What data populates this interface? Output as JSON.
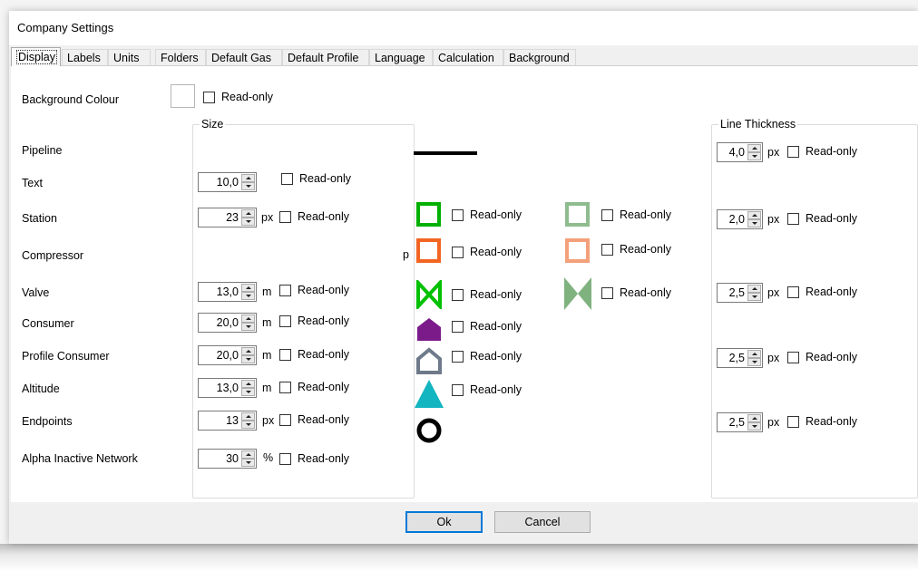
{
  "window": {
    "title": "Company Settings"
  },
  "tabs": [
    "Display",
    "Labels",
    "Units",
    "Folders",
    "Default Gas",
    "Default Profile",
    "Language",
    "Calculation",
    "Background"
  ],
  "display": {
    "background_colour_label": "Background Colour",
    "readonly_label": "Read-only",
    "size_group_title": "Size",
    "line_thickness_group_title": "Line Thickness",
    "rows": {
      "pipeline": {
        "label": "Pipeline",
        "line_thickness": "4,0",
        "line_unit": "px"
      },
      "text": {
        "label": "Text",
        "size": "10,0"
      },
      "station": {
        "label": "Station",
        "size": "23",
        "unit": "px",
        "line_thickness": "2,0",
        "line_unit": "px"
      },
      "compressor": {
        "label": "Compressor",
        "stray_text": "p"
      },
      "valve": {
        "label": "Valve",
        "size": "13,0",
        "unit": "m",
        "line_thickness": "2,5",
        "line_unit": "px"
      },
      "consumer": {
        "label": "Consumer",
        "size": "20,0",
        "unit": "m"
      },
      "profile_consumer": {
        "label": "Profile Consumer",
        "size": "20,0",
        "unit": "m",
        "line_thickness": "2,5",
        "line_unit": "px"
      },
      "altitude": {
        "label": "Altitude",
        "size": "13,0",
        "unit": "m"
      },
      "endpoints": {
        "label": "Endpoints",
        "size": "13",
        "unit": "px",
        "line_thickness": "2,5",
        "line_unit": "px"
      },
      "alpha": {
        "label": "Alpha Inactive Network",
        "size": "30",
        "unit": "%"
      }
    },
    "colors": {
      "station_active": "#00b000",
      "station_inactive": "#8fbc8f",
      "compressor_active": "#f26522",
      "compressor_inactive": "#f4a07a",
      "valve_active": "#00c000",
      "valve_inactive": "#7fb27f",
      "consumer": "#7b1b8a",
      "profile_consumer": "#6e7a8a",
      "altitude": "#12b5c0",
      "endpoint": "#000000"
    }
  },
  "footer": {
    "ok": "Ok",
    "cancel": "Cancel"
  }
}
